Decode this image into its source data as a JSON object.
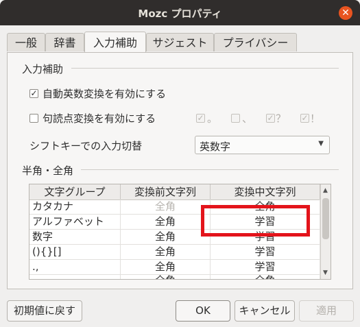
{
  "window": {
    "title": "Mozc プロパティ"
  },
  "tabs": [
    {
      "label": "一般"
    },
    {
      "label": "辞書"
    },
    {
      "label": "入力補助"
    },
    {
      "label": "サジェスト"
    },
    {
      "label": "プライバシー"
    }
  ],
  "input_assist": {
    "section_title": "入力補助",
    "auto_alnum": {
      "label": "自動英数変換を有効にする",
      "checked": true
    },
    "punct_conv": {
      "label": "句読点変換を有効にする",
      "checked": false
    },
    "punct_options": [
      {
        "symbol": "。",
        "checked": true
      },
      {
        "symbol": "、",
        "checked": false
      },
      {
        "symbol": "？",
        "checked": true
      },
      {
        "symbol": "！",
        "checked": true
      }
    ],
    "shift_switch": {
      "label": "シフトキーでの入力切替",
      "value": "英数字"
    }
  },
  "halfwidth": {
    "section_title": "半角・全角",
    "columns": [
      "文字グループ",
      "変換前文字列",
      "変換中文字列"
    ],
    "rows": [
      [
        "カタカナ",
        "全角",
        "全角"
      ],
      [
        "アルファベット",
        "全角",
        "学習"
      ],
      [
        "数字",
        "全角",
        "学習"
      ],
      [
        "(){}[]",
        "全角",
        "学習"
      ],
      [
        ".,",
        "全角",
        "学習"
      ],
      [
        "",
        "全角",
        "全角"
      ]
    ]
  },
  "buttons": {
    "reset": "初期値に戻す",
    "ok": "OK",
    "cancel": "キャンセル",
    "apply": "適用"
  },
  "colors": {
    "titlebar": "#302d2c",
    "close": "#e95420",
    "annotation": "#e3141b"
  }
}
